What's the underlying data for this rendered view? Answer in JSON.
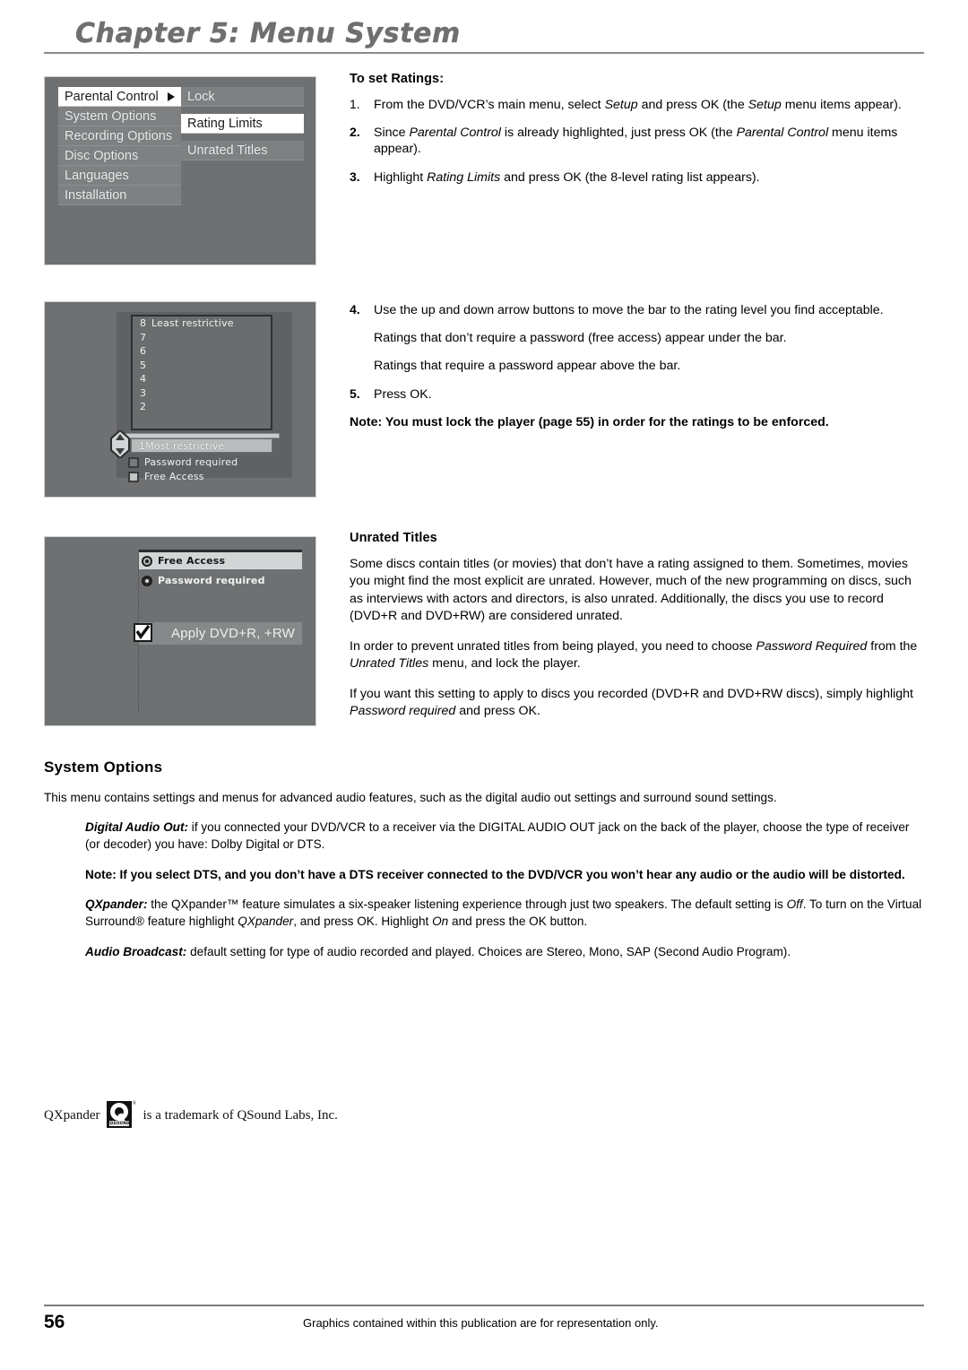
{
  "header": {
    "chapter_title": "Chapter 5: Menu System"
  },
  "screenshots": {
    "menu_shot": {
      "left_menu": [
        {
          "label": "Parental Control",
          "selected": true,
          "arrow": true
        },
        {
          "label": "System Options",
          "selected": false,
          "arrow": false
        },
        {
          "label": "Recording Options",
          "selected": false,
          "arrow": false
        },
        {
          "label": "Disc Options",
          "selected": false,
          "arrow": false
        },
        {
          "label": "Languages",
          "selected": false,
          "arrow": false
        },
        {
          "label": "Installation",
          "selected": false,
          "arrow": false
        }
      ],
      "right_menu": [
        {
          "label": "Lock",
          "selected": false
        },
        {
          "label": "Rating Limits",
          "selected": true
        },
        {
          "label": "Unrated Titles",
          "selected": false
        }
      ]
    },
    "rating_shot": {
      "rows": [
        {
          "num": "8",
          "label": "Least restrictive"
        },
        {
          "num": "7",
          "label": ""
        },
        {
          "num": "6",
          "label": ""
        },
        {
          "num": "5",
          "label": ""
        },
        {
          "num": "4",
          "label": ""
        },
        {
          "num": "3",
          "label": ""
        },
        {
          "num": "2",
          "label": ""
        }
      ],
      "selected_row": {
        "num": "1",
        "label": "Most restrictive"
      },
      "legend": [
        {
          "label": "Password required",
          "swatch": "dark"
        },
        {
          "label": "Free Access",
          "swatch": "light"
        }
      ]
    },
    "unrated_shot": {
      "options": [
        {
          "label": "Free Access",
          "selected": true
        },
        {
          "label": "Password required",
          "selected": false
        }
      ],
      "checkbox": {
        "label": "Apply DVD+R, +RW",
        "checked": true
      }
    }
  },
  "to_set_ratings": {
    "heading": "To set Ratings:",
    "steps": [
      {
        "n": "1.",
        "html": "From the DVD/VCR&rsquo;s main menu, select <i>Setup</i> and press OK (the <i>Setup</i> menu items appear)."
      },
      {
        "n": "2.",
        "html": "Since <i>Parental Control</i> is already highlighted, just press OK (the <i>Parental Control</i> menu items appear)."
      },
      {
        "n": "3.",
        "html": "Highlight <i>Rating Limits</i> and press OK (the 8-level rating list appears)."
      }
    ],
    "steps2": [
      {
        "n": "4.",
        "html": "Use the up and down arrow buttons to move the bar to the rating level you find acceptable."
      }
    ],
    "sub_lines": [
      "Ratings that don&rsquo;t require a password (free access) appear under the bar.",
      "Ratings that require a password appear above the bar."
    ],
    "step5": {
      "n": "5.",
      "html": "Press OK."
    },
    "note": "Note: You must lock the player (page 55) in order for the ratings to be enforced."
  },
  "unrated_titles": {
    "heading": "Unrated Titles",
    "paragraphs": [
      "Some discs contain titles (or movies) that don&rsquo;t have a rating assigned to them. Sometimes, movies you might find the most explicit are unrated. However, much of the new programming on discs, such as interviews with actors and directors, is also unrated. Additionally, the discs you use to record (DVD+R and DVD+RW) are considered unrated.",
      "In order to prevent unrated titles from being played, you need to choose <i>Password Required</i> from the <i>Unrated Titles</i> menu, and lock the player.",
      "If you want this setting to apply to discs you recorded (DVD+R and DVD+RW discs), simply highlight <i>Password required</i> and press OK."
    ]
  },
  "system_options": {
    "heading": "System Options",
    "intro": "This menu contains settings and menus for advanced audio features, such as the digital audio out settings and surround sound settings.",
    "digital_audio_out": "<b><i>Digital Audio Out:</i></b> if you connected your DVD/VCR to a receiver via the DIGITAL AUDIO OUT jack on the back of the player, choose the type of receiver (or decoder) you have: Dolby Digital or DTS.",
    "dts_note": "Note: If you select DTS, and you don&rsquo;t have a DTS receiver connected to the DVD/VCR you won&rsquo;t hear any audio or the audio will be distorted.",
    "qxpander": "<b><i>QXpander:</i></b> the QXpander&trade; feature simulates a six-speaker listening experience through just two speakers. The default setting is <i>Off</i>. To turn on the Virtual Surround&reg; feature highlight <i>QXpander</i>, and press OK. Highlight <i>On</i> and press the OK button.",
    "audio_broadcast": "<b><i>Audio Broadcast:</i></b> default setting for type of audio recorded and played. Choices are Stereo, Mono, SAP (Second Audio Program)."
  },
  "trademark": {
    "prefix": "QXpander",
    "logo_word": "QSOUND",
    "registered": "®",
    "suffix": "is a trademark of QSound Labs, Inc."
  },
  "footer": {
    "page_number": "56",
    "note": "Graphics contained within this publication are for representation only."
  },
  "colors": {
    "header_gray": "#6f6f6f",
    "tv_background": "#6e7072",
    "menu_item": "#7e8082",
    "selected_white": "#ffffff"
  }
}
